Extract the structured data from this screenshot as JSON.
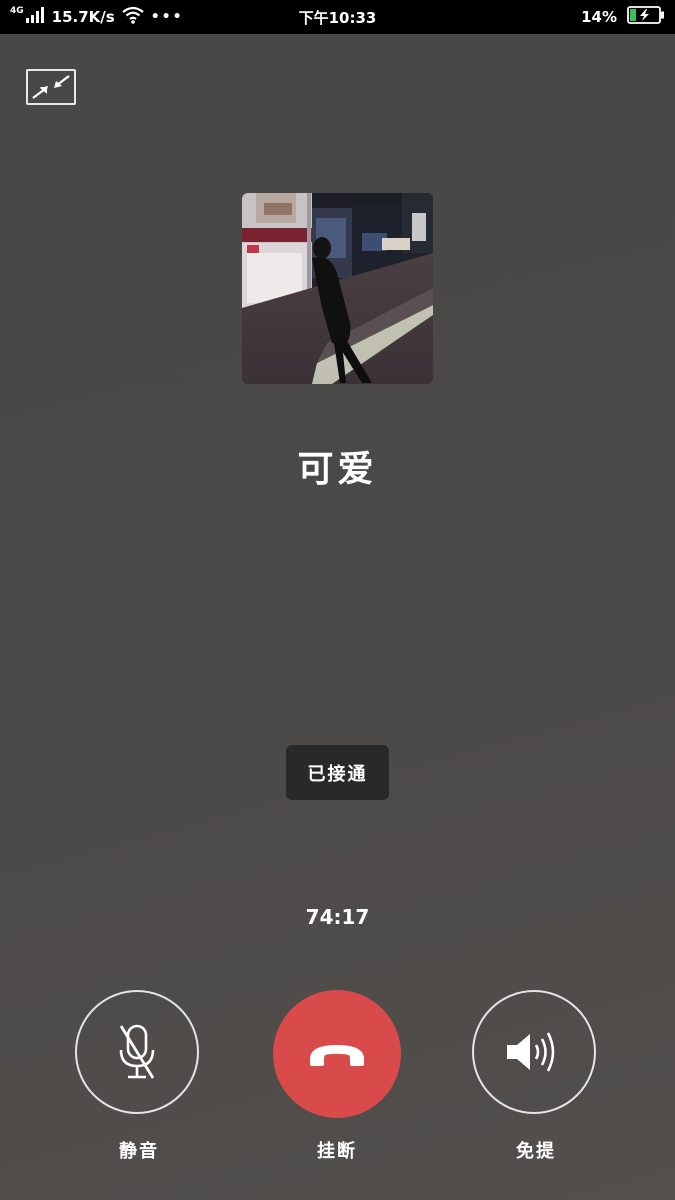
{
  "status_bar": {
    "network": "4G",
    "speed": "15.7K/s",
    "time": "下午10:33",
    "battery": "14%"
  },
  "contact": {
    "name": "可爱"
  },
  "call": {
    "status_toast": "已接通",
    "duration": "74:17"
  },
  "actions": {
    "mute": "静音",
    "hangup": "挂断",
    "speaker": "免提"
  },
  "colors": {
    "hangup_red": "#d94a4a",
    "battery_green": "#39c05a"
  }
}
